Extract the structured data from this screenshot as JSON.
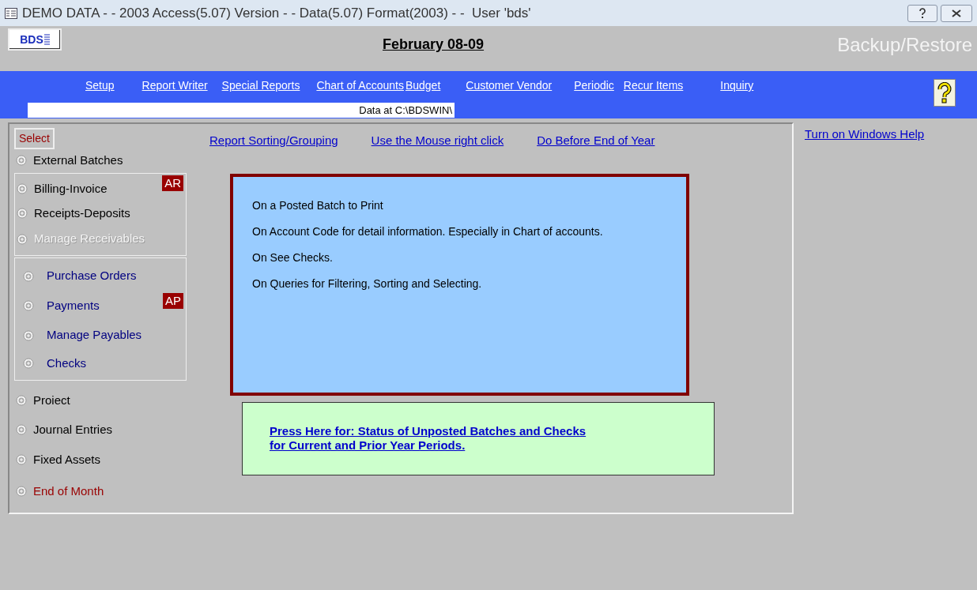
{
  "window": {
    "title": "DEMO DATA - - 2003 Access(5.07) Version - - Data(5.07) Format(2003) - -  User 'bds'"
  },
  "header": {
    "logo": "BDS",
    "period": "February 08-09",
    "backup": "Backup/Restore"
  },
  "menu": [
    "Setup",
    "Report Writer",
    "Special Reports",
    "Chart of Accounts",
    "Budget",
    "Customer Vendor",
    "Periodic",
    "Recur Items",
    "Inquiry"
  ],
  "data_path": "Data at C:\\BDSWIN\\",
  "select_label": "Select",
  "option_groups": [
    {
      "items": [
        {
          "label": "External Batches",
          "selected": false,
          "disabled": false,
          "color": "#000000"
        }
      ]
    },
    {
      "badge": "AR",
      "items": [
        {
          "label": "Billing-Invoice",
          "selected": false,
          "disabled": false,
          "color": "#000000"
        },
        {
          "label": "Receipts-Deposits",
          "selected": false,
          "disabled": false,
          "color": "#000000"
        },
        {
          "label": "Manage Receivables",
          "selected": false,
          "disabled": true
        }
      ]
    },
    {
      "badge": "AP",
      "items": [
        {
          "label": "Purchase Orders",
          "selected": false,
          "disabled": false,
          "color": "#000080"
        },
        {
          "label": "Payments",
          "selected": false,
          "disabled": false,
          "color": "#000080"
        },
        {
          "label": "Manage Payables",
          "selected": false,
          "disabled": false,
          "color": "#000080"
        },
        {
          "label": "Checks",
          "selected": false,
          "disabled": false,
          "color": "#000080"
        }
      ]
    },
    {
      "items": [
        {
          "label": "Proiect",
          "selected": false,
          "disabled": false,
          "color": "#000000"
        },
        {
          "label": "Journal Entries",
          "selected": false,
          "disabled": false,
          "color": "#000000"
        },
        {
          "label": "Fixed Assets",
          "selected": false,
          "disabled": false,
          "color": "#000000"
        },
        {
          "label": "End of Month",
          "selected": false,
          "disabled": false,
          "color": "#990000"
        }
      ]
    }
  ],
  "links": [
    "Report Sorting/Grouping",
    "Use the Mouse right click",
    "Do Before End of Year"
  ],
  "right_click_tips": [
    "On a Posted Batch to Print",
    "On Account Code for detail information.  Especially in Chart of accounts.",
    "On See Checks.",
    "On Queries for Filtering, Sorting and Selecting."
  ],
  "status_button": "Press Here for: Status of Unposted Batches and Checks for Current and Prior Year Periods.",
  "help_link": "Turn on Windows Help"
}
